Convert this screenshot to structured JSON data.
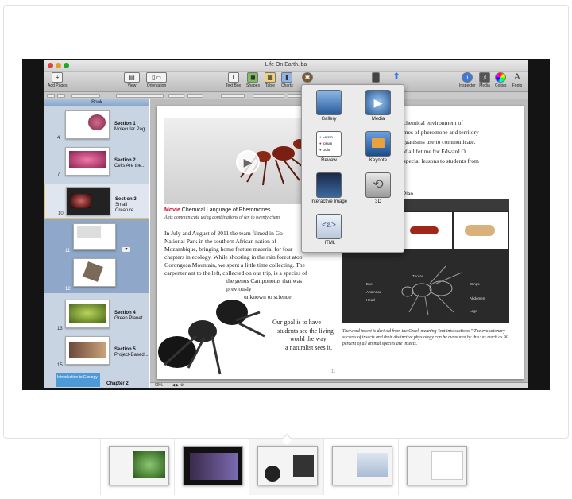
{
  "window": {
    "title": "Life On Earth.iba"
  },
  "toolbar": {
    "add_pages": "Add Pages",
    "view": "View",
    "orientation": "Orientation",
    "text_box": "Text Box",
    "shapes": "Shapes",
    "table": "Table",
    "charts": "Charts",
    "inspector": "Inspector",
    "media": "Media",
    "colors": "Colors",
    "fonts": "Fonts"
  },
  "sidebar": {
    "header": "Book",
    "sections": [
      {
        "num": "4",
        "title": "Section 1",
        "subtitle": "Molecular Pag..."
      },
      {
        "num": "7",
        "title": "Section 2",
        "subtitle": "Cells Are the..."
      },
      {
        "num": "10",
        "title": "Section 3",
        "subtitle": "Small Creature..."
      },
      {
        "num": "13",
        "title": "Section 4",
        "subtitle": "Green Planet"
      },
      {
        "num": "15",
        "title": "Section 5",
        "subtitle": "Project-Based..."
      }
    ],
    "pages_extra": [
      "11",
      "12"
    ],
    "chapter": "Chapter 2",
    "chapter_thumb": "Introduction to Ecology"
  },
  "page": {
    "movie_label": "Movie",
    "movie_title": "Chemical Language of Pheromones",
    "movie_caption": "Ants communicate using combinations of ten to twenty chem",
    "body_lines": [
      "In July and August of 2011 the team filmed in Go",
      "National Park in the southern African nation of",
      "Mozambique, bringing home feature material for four",
      "chapters in ecology. While shooting in the rain forest atop",
      "Gorongosa Mountain, we spent a little time collecting. The",
      "carpenter ant to the left, collected on our trip, is a species of",
      "the genus Camponotus that was previously",
      "unknown to science."
    ],
    "body_lines_2": [
      "Our goal is to have",
      "students see the living",
      "world the way",
      "a naturalist sees it."
    ],
    "right_lines": [
      ", the chemical environment of",
      "e plumes of pheromone and territory-",
      "hat organisms use to communicate.",
      "udy of a lifetime for Edward O.",
      "ome special lessons to students from"
    ],
    "plan_label": "Plan",
    "plan_header": "an",
    "diagram_labels": {
      "thorax": "Thorax",
      "eye": "Eye",
      "antennae": "Antennae",
      "head": "Head",
      "wings": "Wings",
      "abdomen": "Abdomen",
      "legs": "Legs"
    },
    "insect_caption": "The word insect is derived from the Greek meaning \"cut into sections.\" The evolutionary success of insects and their distinctive physiology can be measured by this: as much as 90 percent of all animal species are insects.",
    "page_number": "11"
  },
  "status": {
    "zoom": "99%"
  },
  "widgets": {
    "gallery": "Gallery",
    "media": "Media",
    "review": "Review",
    "keynote": "Keynote",
    "interactive_image": "Interactive Image",
    "three_d": "3D",
    "html": "HTML",
    "html_glyph": "<a>",
    "review_items": [
      "Lorem",
      "Ipsum",
      "Dolor"
    ]
  },
  "colors": {
    "accent": "#3a7bd5",
    "sidebar": "#c8d4e2",
    "movie_red": "#c8102e"
  }
}
